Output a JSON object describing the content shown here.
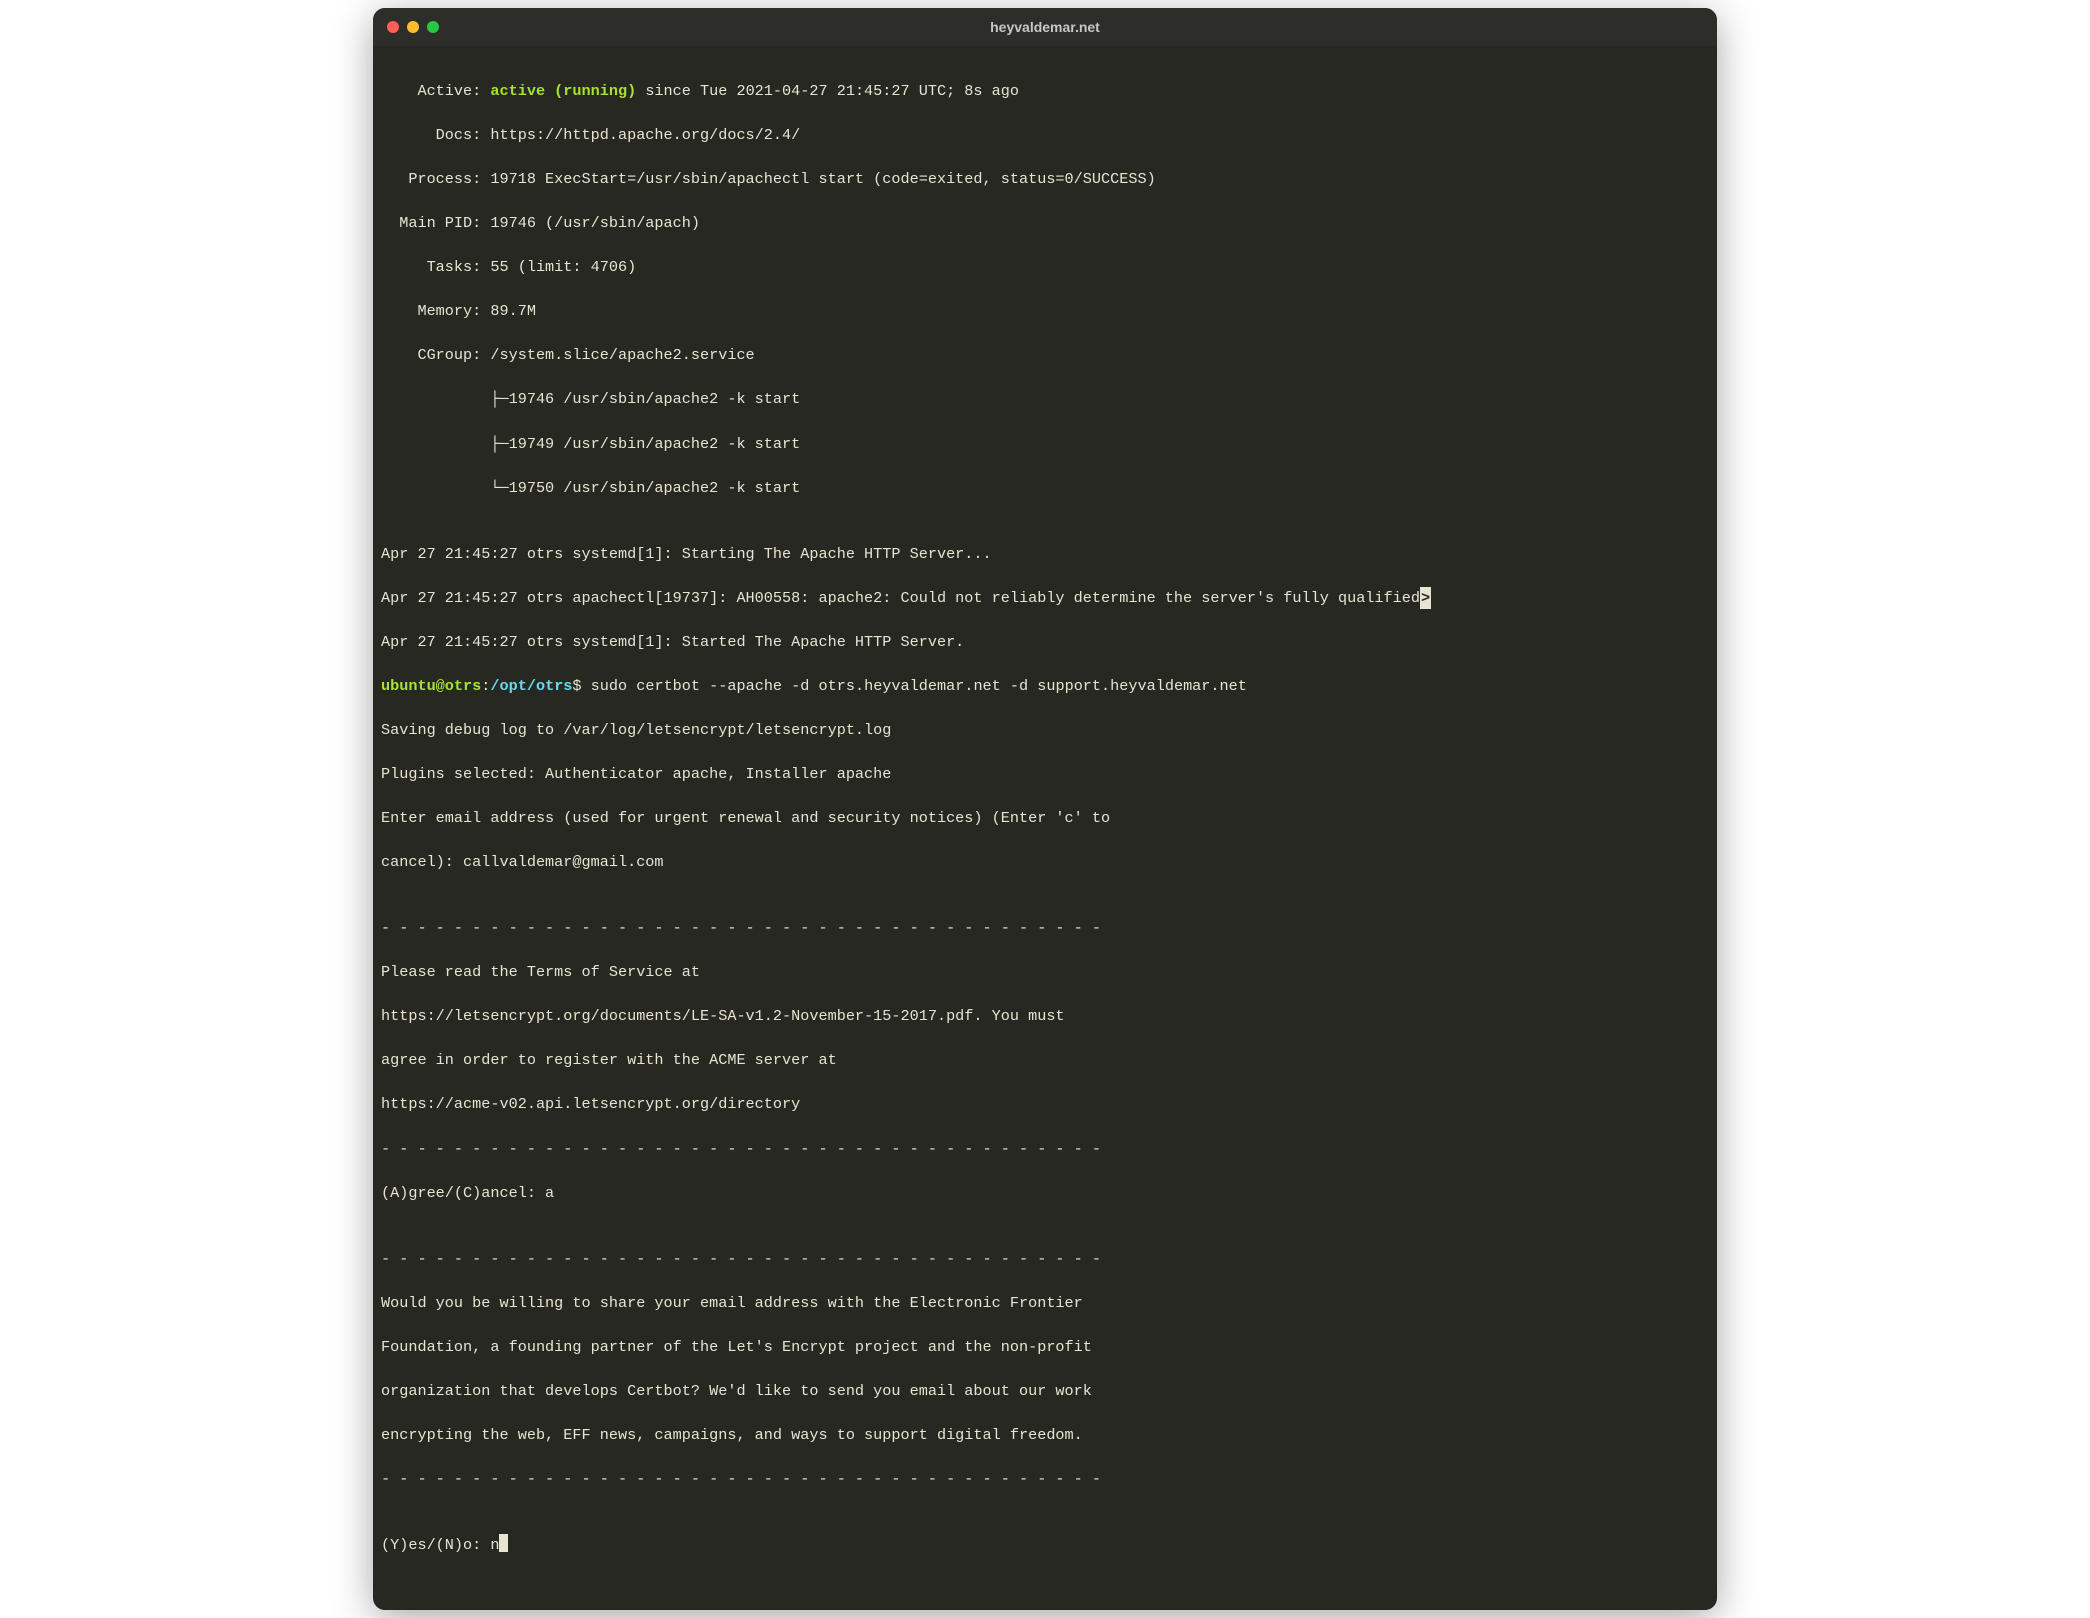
{
  "window_title": "heyvaldemar.net",
  "status": {
    "active_label": "    Active: ",
    "active_value": "active (running)",
    "active_suffix": " since Tue 2021-04-27 21:45:27 UTC; 8s ago",
    "docs": "      Docs: https://httpd.apache.org/docs/2.4/",
    "process": "   Process: 19718 ExecStart=/usr/sbin/apachectl start (code=exited, status=0/SUCCESS)",
    "mainpid": "  Main PID: 19746 (/usr/sbin/apach)",
    "tasks": "     Tasks: 55 (limit: 4706)",
    "memory": "    Memory: 89.7M",
    "cgroup": "    CGroup: /system.slice/apache2.service",
    "p1": "            ├─19746 /usr/sbin/apache2 -k start",
    "p2": "            ├─19749 /usr/sbin/apache2 -k start",
    "p3": "            └─19750 /usr/sbin/apache2 -k start"
  },
  "log": {
    "l1": "Apr 27 21:45:27 otrs systemd[1]: Starting The Apache HTTP Server...",
    "l2": "Apr 27 21:45:27 otrs apachectl[19737]: AH00558: apache2: Could not reliably determine the server's fully qualified",
    "l2_arrow": ">",
    "l3": "Apr 27 21:45:27 otrs systemd[1]: Started The Apache HTTP Server."
  },
  "prompt": {
    "user": "ubuntu@otrs",
    "colon": ":",
    "path": "/opt/otrs",
    "dollar": "$ ",
    "command": "sudo certbot --apache -d otrs.heyvaldemar.net -d support.heyvaldemar.net"
  },
  "certbot": {
    "c1": "Saving debug log to /var/log/letsencrypt/letsencrypt.log",
    "c2": "Plugins selected: Authenticator apache, Installer apache",
    "c3": "Enter email address (used for urgent renewal and security notices) (Enter 'c' to",
    "c4": "cancel): callvaldemar@gmail.com",
    "blank": "",
    "dash": "- - - - - - - - - - - - - - - - - - - - - - - - - - - - - - - - - - - - - - - -",
    "t1": "Please read the Terms of Service at",
    "t2": "https://letsencrypt.org/documents/LE-SA-v1.2-November-15-2017.pdf. You must",
    "t3": "agree in order to register with the ACME server at",
    "t4": "https://acme-v02.api.letsencrypt.org/directory",
    "agree": "(A)gree/(C)ancel: a",
    "e1": "Would you be willing to share your email address with the Electronic Frontier",
    "e2": "Foundation, a founding partner of the Let's Encrypt project and the non-profit",
    "e3": "organization that develops Certbot? We'd like to send you email about our work",
    "e4": "encrypting the web, EFF news, campaigns, and ways to support digital freedom.",
    "yn": "(Y)es/(N)o: n"
  }
}
